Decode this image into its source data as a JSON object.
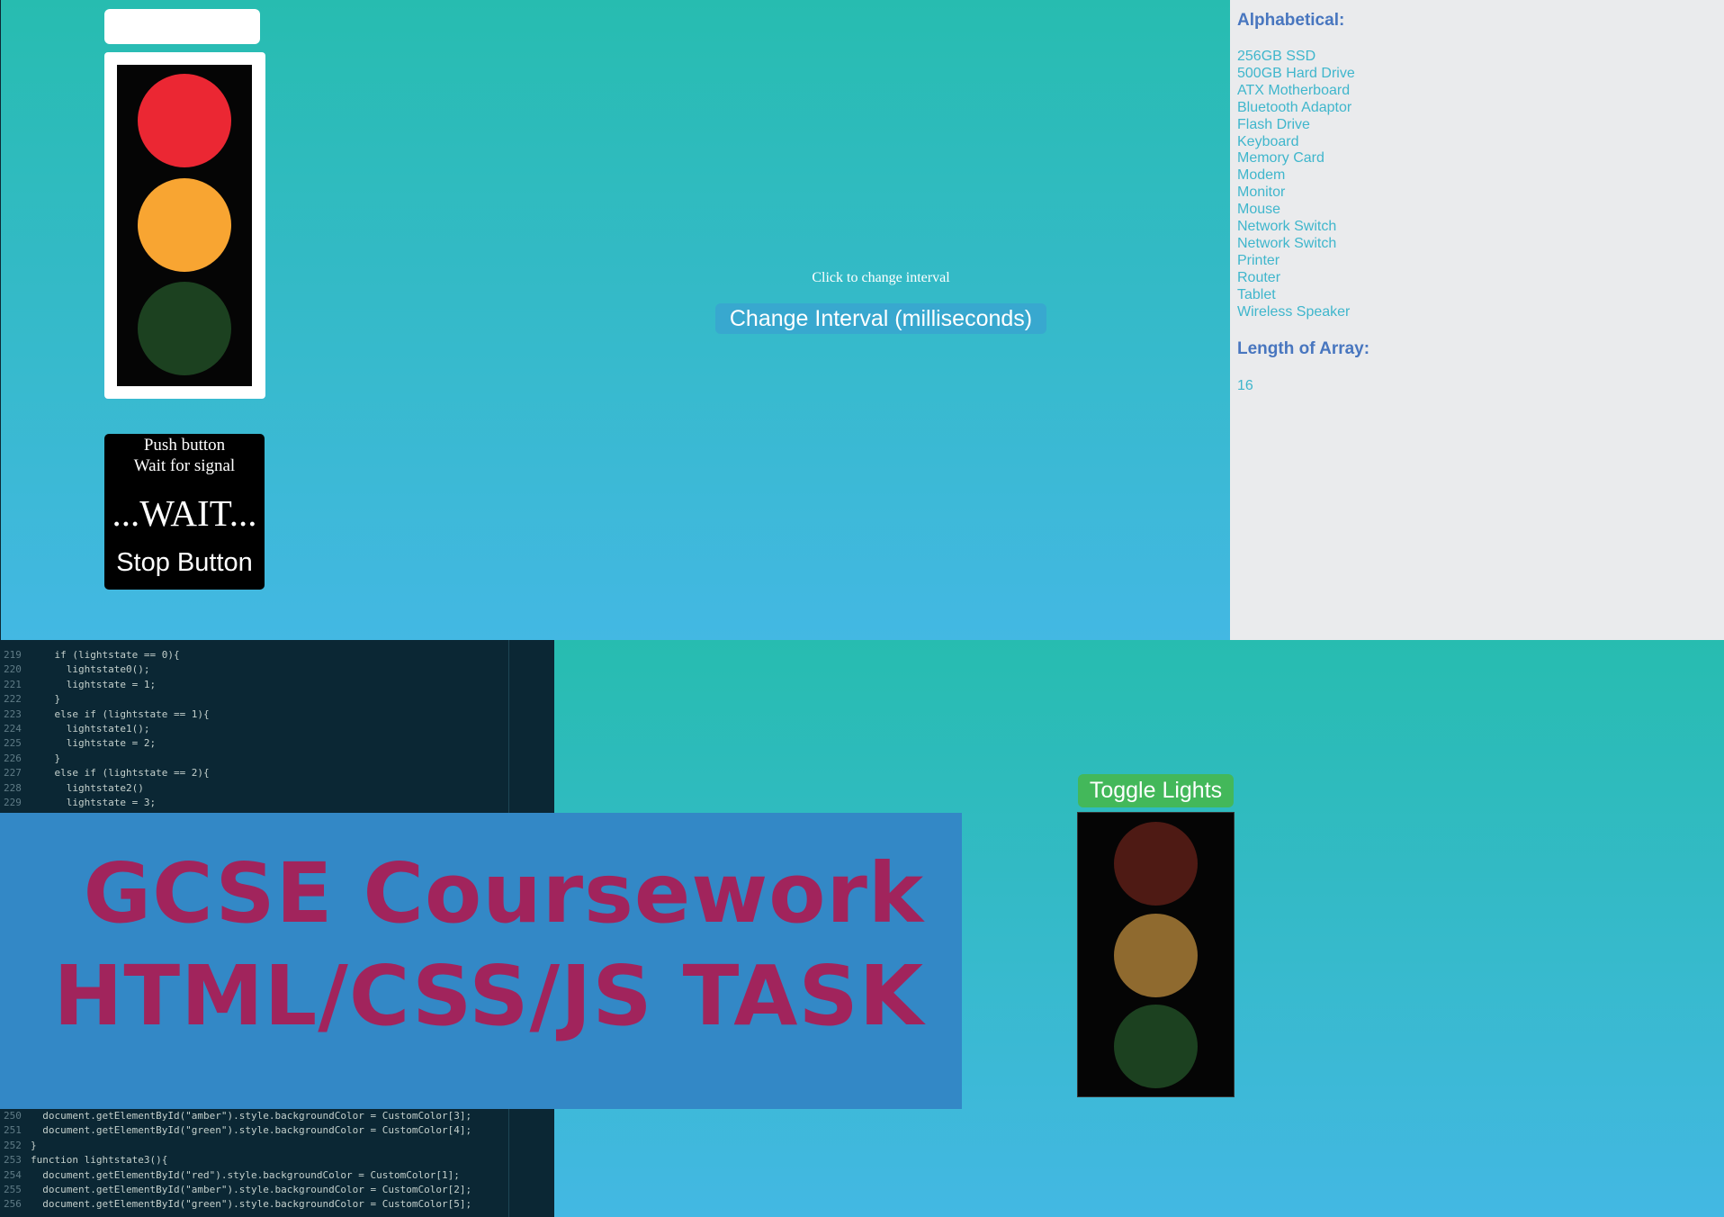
{
  "top": {
    "pedestrian": {
      "line1": "Push button",
      "line2": "Wait for signal",
      "status": "...WAIT...",
      "stop_label": "Stop Button"
    },
    "interval": {
      "caption": "Click to change interval",
      "button_label": "Change Interval (milliseconds)"
    },
    "light_colors": {
      "red": "#eb2733",
      "amber": "#f8a532",
      "green": "#1c4120"
    }
  },
  "sidebar": {
    "alpha_heading": "Alphabetical:",
    "items": [
      "256GB SSD",
      "500GB Hard Drive",
      "ATX Motherboard",
      "Bluetooth Adaptor",
      "Flash Drive",
      "Keyboard",
      "Memory Card",
      "Modem",
      "Monitor",
      "Mouse",
      "Network Switch",
      "Network Switch",
      "Printer",
      "Router",
      "Tablet",
      "Wireless Speaker"
    ],
    "length_heading": "Length of Array:",
    "length_value": "16"
  },
  "code_top": [
    {
      "ln": "219",
      "src": "    if (lightstate == 0){"
    },
    {
      "ln": "220",
      "src": "      lightstate0();"
    },
    {
      "ln": "221",
      "src": "      lightstate = 1;"
    },
    {
      "ln": "222",
      "src": "    }"
    },
    {
      "ln": "223",
      "src": "    else if (lightstate == 1){"
    },
    {
      "ln": "224",
      "src": "      lightstate1();"
    },
    {
      "ln": "225",
      "src": "      lightstate = 2;"
    },
    {
      "ln": "226",
      "src": "    }"
    },
    {
      "ln": "227",
      "src": "    else if (lightstate == 2){"
    },
    {
      "ln": "228",
      "src": "      lightstate2()"
    },
    {
      "ln": "229",
      "src": "      lightstate = 3;"
    }
  ],
  "code_bottom": [
    {
      "ln": "250",
      "src": "  document.getElementById(\"amber\").style.backgroundColor = CustomColor[3];"
    },
    {
      "ln": "251",
      "src": "  document.getElementById(\"green\").style.backgroundColor = CustomColor[4];"
    },
    {
      "ln": "252",
      "src": "}"
    },
    {
      "ln": "253",
      "src": "function lightstate3(){"
    },
    {
      "ln": "254",
      "src": "  document.getElementById(\"red\").style.backgroundColor = CustomColor[1];"
    },
    {
      "ln": "255",
      "src": "  document.getElementById(\"amber\").style.backgroundColor = CustomColor[2];"
    },
    {
      "ln": "256",
      "src": "  document.getElementById(\"green\").style.backgroundColor = CustomColor[5];"
    }
  ],
  "banner": {
    "line1": "GCSE Coursework",
    "line2": "HTML/CSS/JS TASK"
  },
  "toggle": {
    "button_label": "Toggle Lights"
  }
}
